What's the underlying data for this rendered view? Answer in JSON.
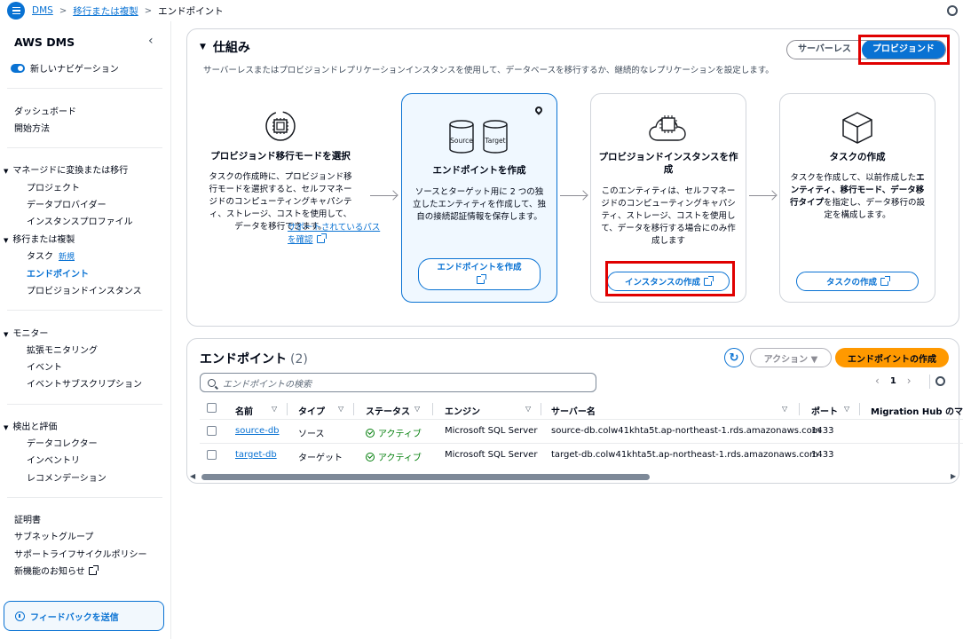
{
  "breadcrumb": {
    "items": [
      "DMS",
      "移行または複製"
    ],
    "current": "エンドポイント"
  },
  "sidebar": {
    "title": "AWS DMS",
    "new_nav_label": "新しいナビゲーション",
    "top_links": [
      "ダッシュボード",
      "開始方法"
    ],
    "sections": [
      {
        "title": "マネージドに変換または移行",
        "items": [
          "プロジェクト",
          "データプロバイダー",
          "インスタンスプロファイル"
        ]
      },
      {
        "title": "移行または複製",
        "items": [
          "タスク",
          "エンドポイント",
          "プロビジョンドインスタンス"
        ],
        "new_badge": "新規"
      },
      {
        "title": "モニター",
        "items": [
          "拡張モニタリング",
          "イベント",
          "イベントサブスクリプション"
        ]
      },
      {
        "title": "検出と評価",
        "items": [
          "データコレクター",
          "インベントリ",
          "レコメンデーション"
        ]
      }
    ],
    "bottom_links": [
      "証明書",
      "サブネットグループ",
      "サポートライフサイクルポリシー",
      "新機能のお知らせ"
    ],
    "feedback_label": "フィードバックを送信"
  },
  "how": {
    "title": "仕組み",
    "description": "サーバーレスまたはプロビジョンドレプリケーションインスタンスを使用して、データベースを移行するか、継続的なレプリケーションを設定します。",
    "modes": [
      "サーバーレス",
      "プロビジョンド"
    ],
    "cards": [
      {
        "title": "プロビジョンド移行モードを選択",
        "text": "タスクの作成時に、プロビジョンド移行モードを選択すると、セルフマネージドのコンピューティングキャパシティ、ストレージ、コストを使用して、データを移行できます。",
        "link": "サポートされているパスを確認"
      },
      {
        "title": "エンドポイントを作成",
        "text": "ソースとターゲット用に 2 つの独立したエンティティを作成して、独自の接続認証情報を保存します。",
        "button": "エンドポイントを作成",
        "db_labels": [
          "Source",
          "Target"
        ]
      },
      {
        "title": "プロビジョンドインスタンスを作成",
        "text": "このエンティティは、セルフマネージドのコンピューティングキャパシティ、ストレージ、コストを使用して、データを移行する場合にのみ作成します",
        "button": "インスタンスの作成"
      },
      {
        "title": "タスクの作成",
        "text_plain1": "タスクを作成して、以前作成した",
        "text_bold": "エンティティ、移行モード、データ移行タイプ",
        "text_plain2": "を指定し、データ移行の設定を構成します。",
        "button": "タスクの作成"
      }
    ]
  },
  "endpoints": {
    "title": "エンドポイント",
    "count": "(2)",
    "action_label": "アクション ▼",
    "create_label": "エンドポイントの作成",
    "search_placeholder": "エンドポイントの検索",
    "page": "1",
    "columns": [
      "名前",
      "タイプ",
      "ステータス",
      "エンジン",
      "サーバー名",
      "ポート",
      "Migration Hub のマッピ"
    ],
    "rows": [
      {
        "name": "source-db",
        "type": "ソース",
        "status": "アクティブ",
        "engine": "Microsoft SQL Server",
        "server": "source-db.colw41khta5t.ap-northeast-1.rds.amazonaws.com",
        "port": "1433"
      },
      {
        "name": "target-db",
        "type": "ターゲット",
        "status": "アクティブ",
        "engine": "Microsoft SQL Server",
        "server": "target-db.colw41khta5t.ap-northeast-1.rds.amazonaws.com",
        "port": "1433"
      }
    ]
  },
  "colors": {
    "accent": "#0972d3",
    "create_button": "#ff9900",
    "status_ok": "#037f0c",
    "highlight_box": "#e00000"
  }
}
